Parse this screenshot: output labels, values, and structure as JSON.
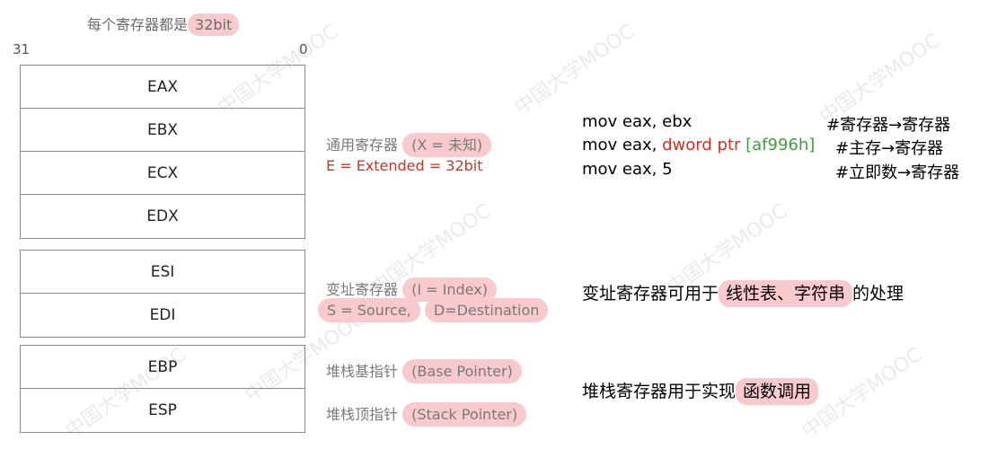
{
  "header": {
    "title_prefix": "每个寄存器都是",
    "title_highlight": "32bit",
    "bit_high": "31",
    "bit_low": "0"
  },
  "registers": {
    "general": [
      "EAX",
      "EBX",
      "ECX",
      "EDX"
    ],
    "index": [
      "ESI",
      "EDI"
    ],
    "stack": [
      "EBP",
      "ESP"
    ]
  },
  "notes": {
    "general_label": "通用寄存器",
    "general_pill": "(X = 未知)",
    "general_extended": "E = Extended = 32bit",
    "index_label": "变址寄存器",
    "index_pill": "(I = Index)",
    "index_source": "S = Source,",
    "index_dest": "D=Destination",
    "base_label": "堆栈基指针",
    "base_pill": "(Base Pointer)",
    "top_label": "堆栈顶指针",
    "top_pill": "(Stack Pointer)"
  },
  "code": {
    "line1": "mov eax, ebx",
    "line1_comment": "#寄存器→寄存器",
    "line2_prefix": "mov eax, ",
    "line2_red": "dword ptr",
    "line2_green": " [af996h]",
    "line2_comment": "#主存→寄存器",
    "line3": "mov eax, 5",
    "line3_comment": "#立即数→寄存器"
  },
  "descriptions": {
    "index_prefix": "变址寄存器可用于",
    "index_highlight": "线性表、字符串",
    "index_suffix": "的处理",
    "stack_prefix": "堆栈寄存器用于实现",
    "stack_highlight": "函数调用"
  },
  "colors": {
    "highlight": "#f8c9cd",
    "red": "#d62c1e",
    "green": "#3aa13a",
    "gray_text": "#7a7a7a"
  }
}
